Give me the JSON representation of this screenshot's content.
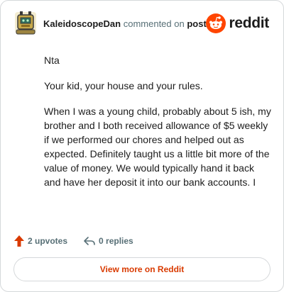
{
  "header": {
    "username": "KaleidoscopeDan",
    "action_text": "commented on",
    "post_link": "post",
    "brand": "reddit",
    "brand_color": "#ff4500"
  },
  "comment": {
    "paragraphs": [
      "Nta",
      "Your kid, your house and your rules.",
      "When I was a young child, probably about 5 ish, my brother and I both received allowance of $5 weekly if we performed our chores and helped out as expected. Definitely taught us a little bit more of the value of money. We would typically hand it back and have her deposit it into our bank accounts. I"
    ]
  },
  "actions": {
    "upvotes_label": "2 upvotes",
    "upvote_icon": "upvote-arrow-icon",
    "upvote_color": "#d93a00",
    "replies_label": "0 replies",
    "reply_icon": "reply-arrow-icon"
  },
  "footer": {
    "view_more_label": "View more on Reddit",
    "accent_color": "#d93a00"
  }
}
